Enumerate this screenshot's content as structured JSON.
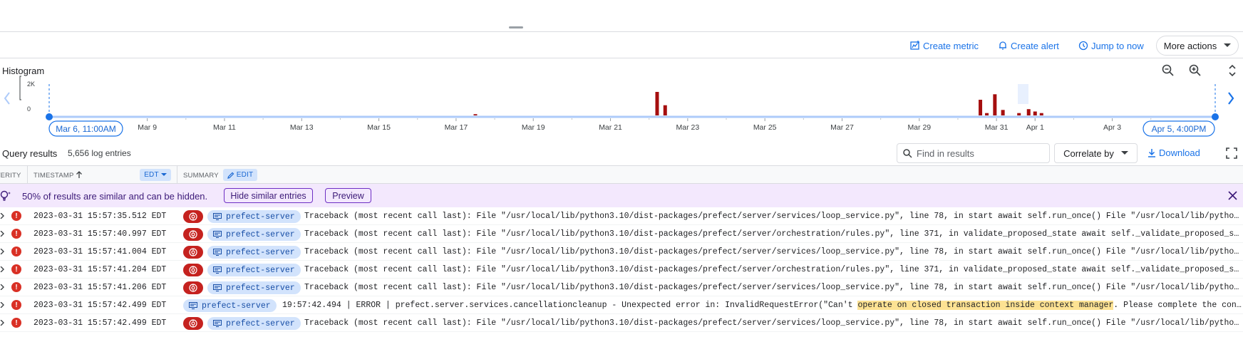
{
  "actionbar": {
    "create_metric": "Create metric",
    "create_alert": "Create alert",
    "jump_to_now": "Jump to now",
    "more_actions": "More actions"
  },
  "histogram": {
    "title": "Histogram",
    "y_max_label": "2K",
    "y_min_label": "0",
    "range_start": "Mar 6, 11:00AM",
    "range_end": "Apr 5, 4:00PM",
    "ticks": [
      "Mar 9",
      "Mar 11",
      "Mar 13",
      "Mar 15",
      "Mar 17",
      "Mar 19",
      "Mar 21",
      "Mar 23",
      "Mar 25",
      "Mar 27",
      "Mar 29",
      "Mar 31",
      "Apr 1",
      "Apr 3"
    ],
    "bar_color": "#a50e0e"
  },
  "chart_data": {
    "type": "bar",
    "ylim": [
      0,
      2000
    ],
    "y_ticks": [
      "0",
      "2K"
    ],
    "x_ticks": [
      "Mar 9",
      "Mar 11",
      "Mar 13",
      "Mar 15",
      "Mar 17",
      "Mar 19",
      "Mar 21",
      "Mar 23",
      "Mar 25",
      "Mar 27",
      "Mar 29",
      "Mar 31",
      "Apr 1",
      "Apr 3"
    ],
    "x_range": [
      "Mar 6, 11:00AM",
      "Apr 5, 4:00PM"
    ],
    "grid": false,
    "x": [
      "2023-03-17 12:00",
      "2023-03-22 05:00",
      "2023-03-22 10:00",
      "2023-03-30 14:00",
      "2023-03-30 18:00",
      "2023-03-30 23:00",
      "2023-03-31 04:00",
      "2023-03-31 14:00",
      "2023-03-31 20:00",
      "2023-04-01 00:00",
      "2023-04-01 04:00"
    ],
    "values": [
      80,
      1500,
      650,
      1000,
      150,
      1350,
      350,
      150,
      400,
      250,
      150
    ]
  },
  "results": {
    "title": "Query results",
    "count": "5,656 log entries",
    "find_placeholder": "Find in results",
    "correlate": "Correlate by",
    "download": "Download"
  },
  "columns": {
    "severity": "SEVERITY",
    "timestamp": "TIMESTAMP",
    "tz": "EDT",
    "summary": "SUMMARY",
    "edit": "EDIT"
  },
  "similar": {
    "text": "50% of results are similar and can be hidden.",
    "hide_btn": "Hide similar entries",
    "preview_btn": "Preview"
  },
  "rows": [
    {
      "ts": "2023-03-31 15:57:35.512 EDT",
      "svc": "prefect-server",
      "app_chip": true,
      "msg": "Traceback (most recent call last): File \"/usr/local/lib/python3.10/dist-packages/prefect/server/services/loop_service.py\", line 78, in start await self.run_once() File \"/usr/local/lib/python3.10/dist-packages"
    },
    {
      "ts": "2023-03-31 15:57:40.997 EDT",
      "svc": "prefect-server",
      "app_chip": true,
      "msg": "Traceback (most recent call last): File \"/usr/local/lib/python3.10/dist-packages/prefect/server/orchestration/rules.py\", line 371, in validate_proposed_state await self._validate_proposed_state() File"
    },
    {
      "ts": "2023-03-31 15:57:41.004 EDT",
      "svc": "prefect-server",
      "app_chip": true,
      "msg": "Traceback (most recent call last): File \"/usr/local/lib/python3.10/dist-packages/prefect/server/services/loop_service.py\", line 78, in start await self.run_once() File \"/usr/local/lib/python3.10/dist-packages"
    },
    {
      "ts": "2023-03-31 15:57:41.204 EDT",
      "svc": "prefect-server",
      "app_chip": true,
      "msg": "Traceback (most recent call last): File \"/usr/local/lib/python3.10/dist-packages/prefect/server/orchestration/rules.py\", line 371, in validate_proposed_state await self._validate_proposed_state() File"
    },
    {
      "ts": "2023-03-31 15:57:41.206 EDT",
      "svc": "prefect-server",
      "app_chip": true,
      "msg": "Traceback (most recent call last): File \"/usr/local/lib/python3.10/dist-packages/prefect/server/services/loop_service.py\", line 78, in start await self.run_once() File \"/usr/local/lib/python3.10/dist-packages"
    },
    {
      "ts": "2023-03-31 15:57:42.499 EDT",
      "svc": "prefect-server",
      "app_chip": false,
      "msg_pre": "19:57:42.494 | ERROR | prefect.server.services.cancellationcleanup - Unexpected error in: InvalidRequestError(\"Can't ",
      "msg_hl": "operate on closed transaction inside context manager",
      "msg_post": ". Please complete the context manager before emitting further commands.\")"
    },
    {
      "ts": "2023-03-31 15:57:42.499 EDT",
      "svc": "prefect-server",
      "app_chip": true,
      "msg": "Traceback (most recent call last): File \"/usr/local/lib/python3.10/dist-packages/prefect/server/services/loop_service.py\", line 78, in start await self.run_once() File \"/usr/local/lib/python3.10/dist-packages"
    }
  ],
  "icons": {
    "severity": "!",
    "accent": "#1a73e8",
    "error": "#d93025"
  }
}
